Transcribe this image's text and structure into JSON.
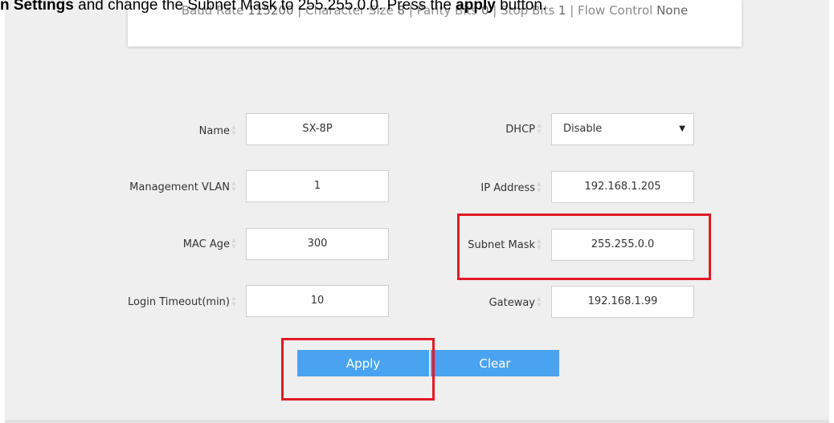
{
  "document": {
    "instruction_bold_1": "n Settings",
    "instruction_text_1": " and change the Subnet Mask to 255.255.0.0. Press the ",
    "instruction_bold_2": "apply",
    "instruction_text_2": " button."
  },
  "summary": {
    "text_1": "Baud Rate ",
    "baud_value": "115200",
    "text_2": " | Character Size ",
    "char_value": "8",
    "text_3": " | Parity Bits ",
    "parity_value": "0",
    "text_4": " | Stop Bits ",
    "stop_value": "1",
    "text_5": " | Flow Control ",
    "flow_value": "None"
  },
  "form": {
    "name": {
      "label": "Name",
      "value": "SX-8P"
    },
    "management_vlan": {
      "label": "Management VLAN",
      "value": "1"
    },
    "mac_age": {
      "label": "MAC Age",
      "value": "300"
    },
    "login_timeout": {
      "label": "Login Timeout(min)",
      "value": "10"
    },
    "dhcp": {
      "label": "DHCP",
      "value": "Disable",
      "options": [
        "Disable"
      ]
    },
    "ip_address": {
      "label": "IP Address",
      "value": "192.168.1.205"
    },
    "subnet_mask": {
      "label": "Subnet Mask",
      "value": "255.255.0.0"
    },
    "gateway": {
      "label": "Gateway",
      "value": "192.168.1.99"
    }
  },
  "buttons": {
    "apply": "Apply",
    "clear": "Clear"
  },
  "colors": {
    "accent_button": "#4aa3f0",
    "highlight_red": "#e01b24",
    "panel_background": "#efefef"
  },
  "annotations": [
    "subnet-mask-highlight",
    "apply-button-highlight"
  ]
}
